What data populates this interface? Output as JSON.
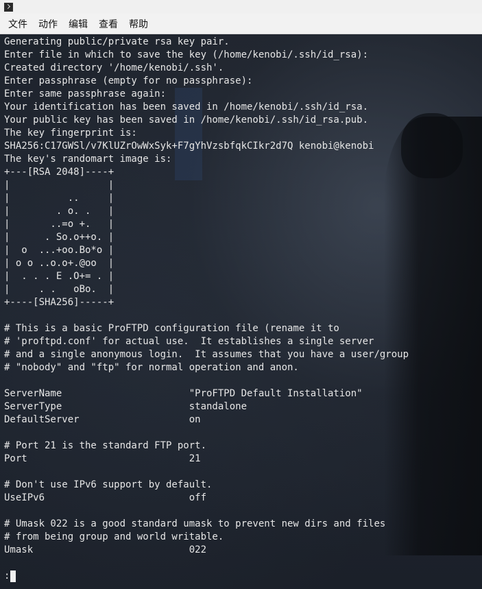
{
  "menubar": {
    "items": [
      "文件",
      "动作",
      "编辑",
      "查看",
      "帮助"
    ]
  },
  "terminal": {
    "lines": [
      "Generating public/private rsa key pair.",
      "Enter file in which to save the key (/home/kenobi/.ssh/id_rsa):",
      "Created directory '/home/kenobi/.ssh'.",
      "Enter passphrase (empty for no passphrase):",
      "Enter same passphrase again:",
      "Your identification has been saved in /home/kenobi/.ssh/id_rsa.",
      "Your public key has been saved in /home/kenobi/.ssh/id_rsa.pub.",
      "The key fingerprint is:",
      "SHA256:C17GWSl/v7KlUZrOwWxSyk+F7gYhVzsbfqkCIkr2d7Q kenobi@kenobi",
      "The key's randomart image is:",
      "+---[RSA 2048]----+",
      "|                 |",
      "|          ..     |",
      "|        . o. .   |",
      "|       ..=o +.   |",
      "|      . So.o++o. |",
      "|  o  ...+oo.Bo*o |",
      "| o o ..o.o+.@oo  |",
      "|  . . . E .O+= . |",
      "|     . .   oBo.  |",
      "+----[SHA256]-----+",
      "",
      "# This is a basic ProFTPD configuration file (rename it to",
      "# 'proftpd.conf' for actual use.  It establishes a single server",
      "# and a single anonymous login.  It assumes that you have a user/group",
      "# \"nobody\" and \"ftp\" for normal operation and anon.",
      "",
      "ServerName                      \"ProFTPD Default Installation\"",
      "ServerType                      standalone",
      "DefaultServer                   on",
      "",
      "# Port 21 is the standard FTP port.",
      "Port                            21",
      "",
      "# Don't use IPv6 support by default.",
      "UseIPv6                         off",
      "",
      "# Umask 022 is a good standard umask to prevent new dirs and files",
      "# from being group and world writable.",
      "Umask                           022"
    ],
    "prompt": ":"
  },
  "colors": {
    "terminal_text": "#e6e6e6",
    "terminal_bg": "#1e232c",
    "menubar_bg": "#f2f2f2"
  }
}
